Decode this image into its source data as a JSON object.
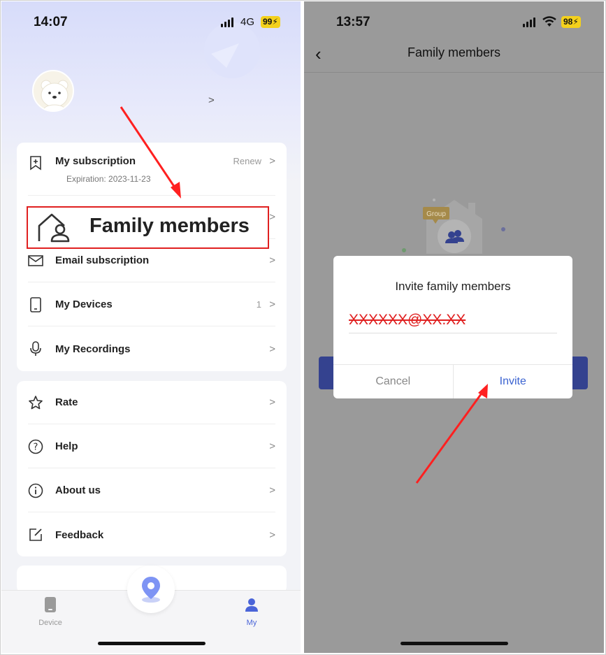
{
  "left": {
    "status": {
      "time": "14:07",
      "network": "4G",
      "battery": "99"
    },
    "menu": [
      {
        "label": "My subscription",
        "sub": "Expiration: 2023-11-23",
        "meta": "Renew"
      },
      {
        "label": "Family members"
      },
      {
        "label": "Email subscription"
      },
      {
        "label": "My Devices",
        "meta": "1"
      },
      {
        "label": "My Recordings"
      }
    ],
    "menu2": [
      {
        "label": "Rate"
      },
      {
        "label": "Help"
      },
      {
        "label": "About us"
      },
      {
        "label": "Feedback"
      }
    ],
    "tabs": {
      "device": "Device",
      "my": "My"
    }
  },
  "right": {
    "status": {
      "time": "13:57",
      "battery": "98"
    },
    "nav_title": "Family members",
    "group_badge": "Group",
    "dialog": {
      "title": "Invite family members",
      "input_value": "XXXXXX@XX.XX",
      "cancel": "Cancel",
      "invite": "Invite"
    }
  },
  "colors": {
    "accent": "#3b63d1",
    "highlight": "#e02020",
    "battery": "#f4d11c",
    "primary_button": "#34428f"
  }
}
